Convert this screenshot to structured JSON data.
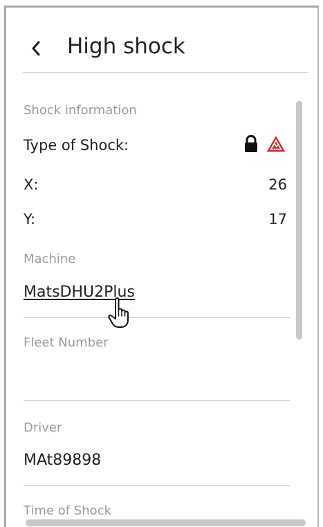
{
  "header": {
    "back_icon": "chevron-left-icon",
    "title": "High shock"
  },
  "shock_info": {
    "caption": "Shock information",
    "type_label": "Type of Shock:",
    "type_icons": [
      "lock-icon",
      "warning-triangle-icon"
    ],
    "x_label": "X:",
    "x_value": "26",
    "y_label": "Y:",
    "y_value": "17"
  },
  "machine": {
    "caption": "Machine",
    "value": "MatsDHU2Plus"
  },
  "fleet_number": {
    "caption": "Fleet Number",
    "value": ""
  },
  "driver": {
    "caption": "Driver",
    "value": "MAt89898"
  },
  "time_of_shock": {
    "caption": "Time of Shock"
  },
  "colors": {
    "warning": "#d8303a",
    "caption": "#9a9a9a",
    "text": "#1f1f1f",
    "border": "#a9a9a9"
  }
}
